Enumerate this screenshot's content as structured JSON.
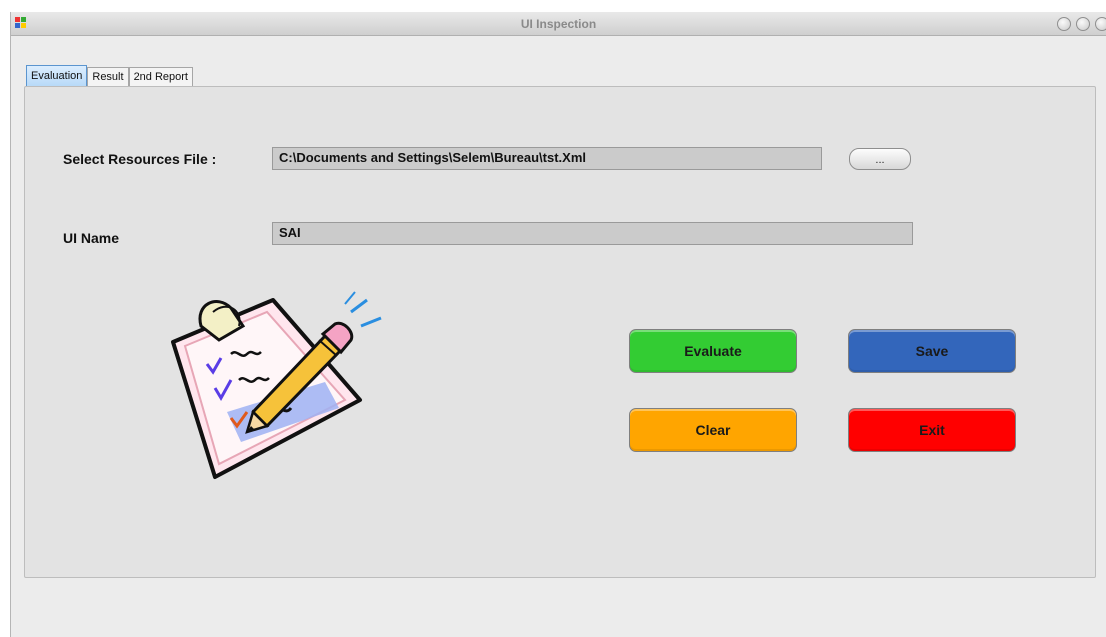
{
  "window": {
    "title": "UI Inspection"
  },
  "tabs": [
    {
      "label": "Evaluation",
      "active": true
    },
    {
      "label": "Result",
      "active": false
    },
    {
      "label": "2nd Report",
      "active": false
    }
  ],
  "form": {
    "resources_label": "Select Resources File :",
    "resources_value": "C:\\Documents and Settings\\Selem\\Bureau\\tst.Xml",
    "browse_label": "...",
    "ui_name_label": "UI Name",
    "ui_name_value": "SAI"
  },
  "buttons": {
    "evaluate": {
      "label": "Evaluate",
      "color": "#33cc33"
    },
    "save": {
      "label": "Save",
      "color": "#3366bb"
    },
    "clear": {
      "label": "Clear",
      "color": "#ffa500"
    },
    "exit": {
      "label": "Exit",
      "color": "#ff0000"
    }
  },
  "illustration": {
    "icon": "clipboard-checklist-pencil-icon"
  }
}
